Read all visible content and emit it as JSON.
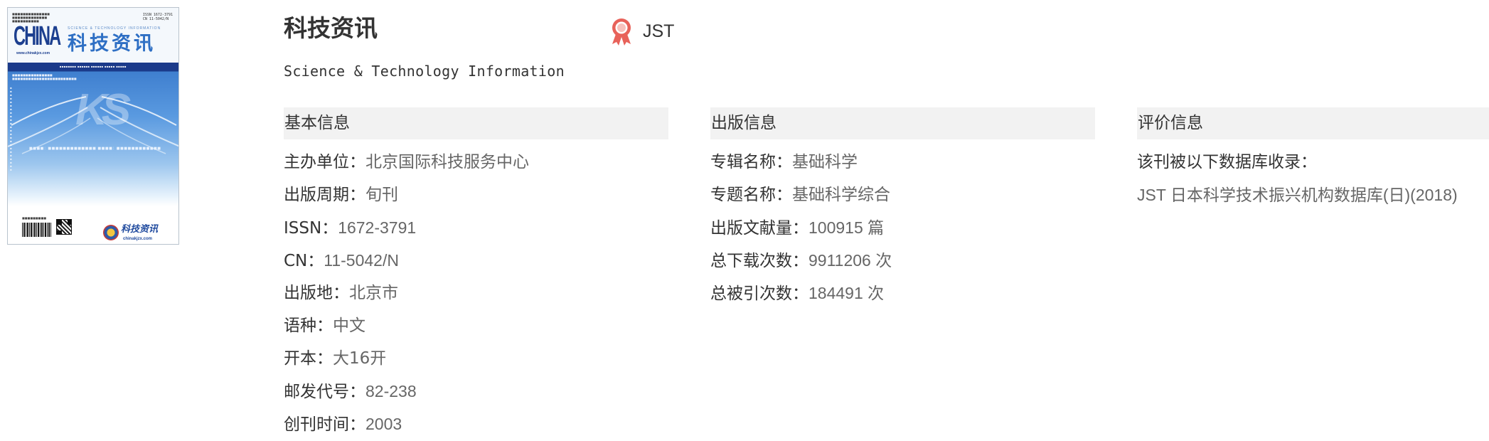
{
  "cover": {
    "brand_wordmark": "CHINA",
    "title_cn": "科技资讯",
    "title_en": "SCIENCE & TECHNOLOGY INFORMATION",
    "site_url": "www.chinakjzx.com",
    "issn": "ISSN 1672-3791",
    "cn": "CN 11-5042/N",
    "brand_name": "科技资讯",
    "brand_url": "chinakjzx.com"
  },
  "journal": {
    "title_cn": "科技资讯",
    "title_en": "Science & Technology Information",
    "badge_label": "JST"
  },
  "basic_info": {
    "heading": "基本信息",
    "rows": [
      {
        "label": "主办单位：",
        "value": "北京国际科技服务中心"
      },
      {
        "label": "出版周期：",
        "value": "旬刊"
      },
      {
        "label": "ISSN：",
        "value": "1672-3791"
      },
      {
        "label": "CN：",
        "value": "11-5042/N"
      },
      {
        "label": "出版地：",
        "value": "北京市"
      },
      {
        "label": "语种：",
        "value": "中文"
      },
      {
        "label": "开本：",
        "value": "大16开"
      },
      {
        "label": "邮发代号：",
        "value": "82-238"
      },
      {
        "label": "创刊时间：",
        "value": "2003"
      }
    ]
  },
  "publish_info": {
    "heading": "出版信息",
    "rows": [
      {
        "label": "专辑名称：",
        "value": "基础科学"
      },
      {
        "label": "专题名称：",
        "value": "基础科学综合"
      },
      {
        "label": "出版文献量：",
        "value": "100915 篇"
      },
      {
        "label": "总下载次数：",
        "value": "9911206 次"
      },
      {
        "label": "总被引次数：",
        "value": "184491 次"
      }
    ]
  },
  "evaluation_info": {
    "heading": "评价信息",
    "indexed_label": "该刊被以下数据库收录：",
    "databases": [
      "JST 日本科学技术振兴机构数据库(日)(2018)"
    ]
  },
  "colors": {
    "label_text": "#333333",
    "value_text": "#666666",
    "header_bg": "#f2f2f2",
    "badge_accent": "#e8625a"
  }
}
